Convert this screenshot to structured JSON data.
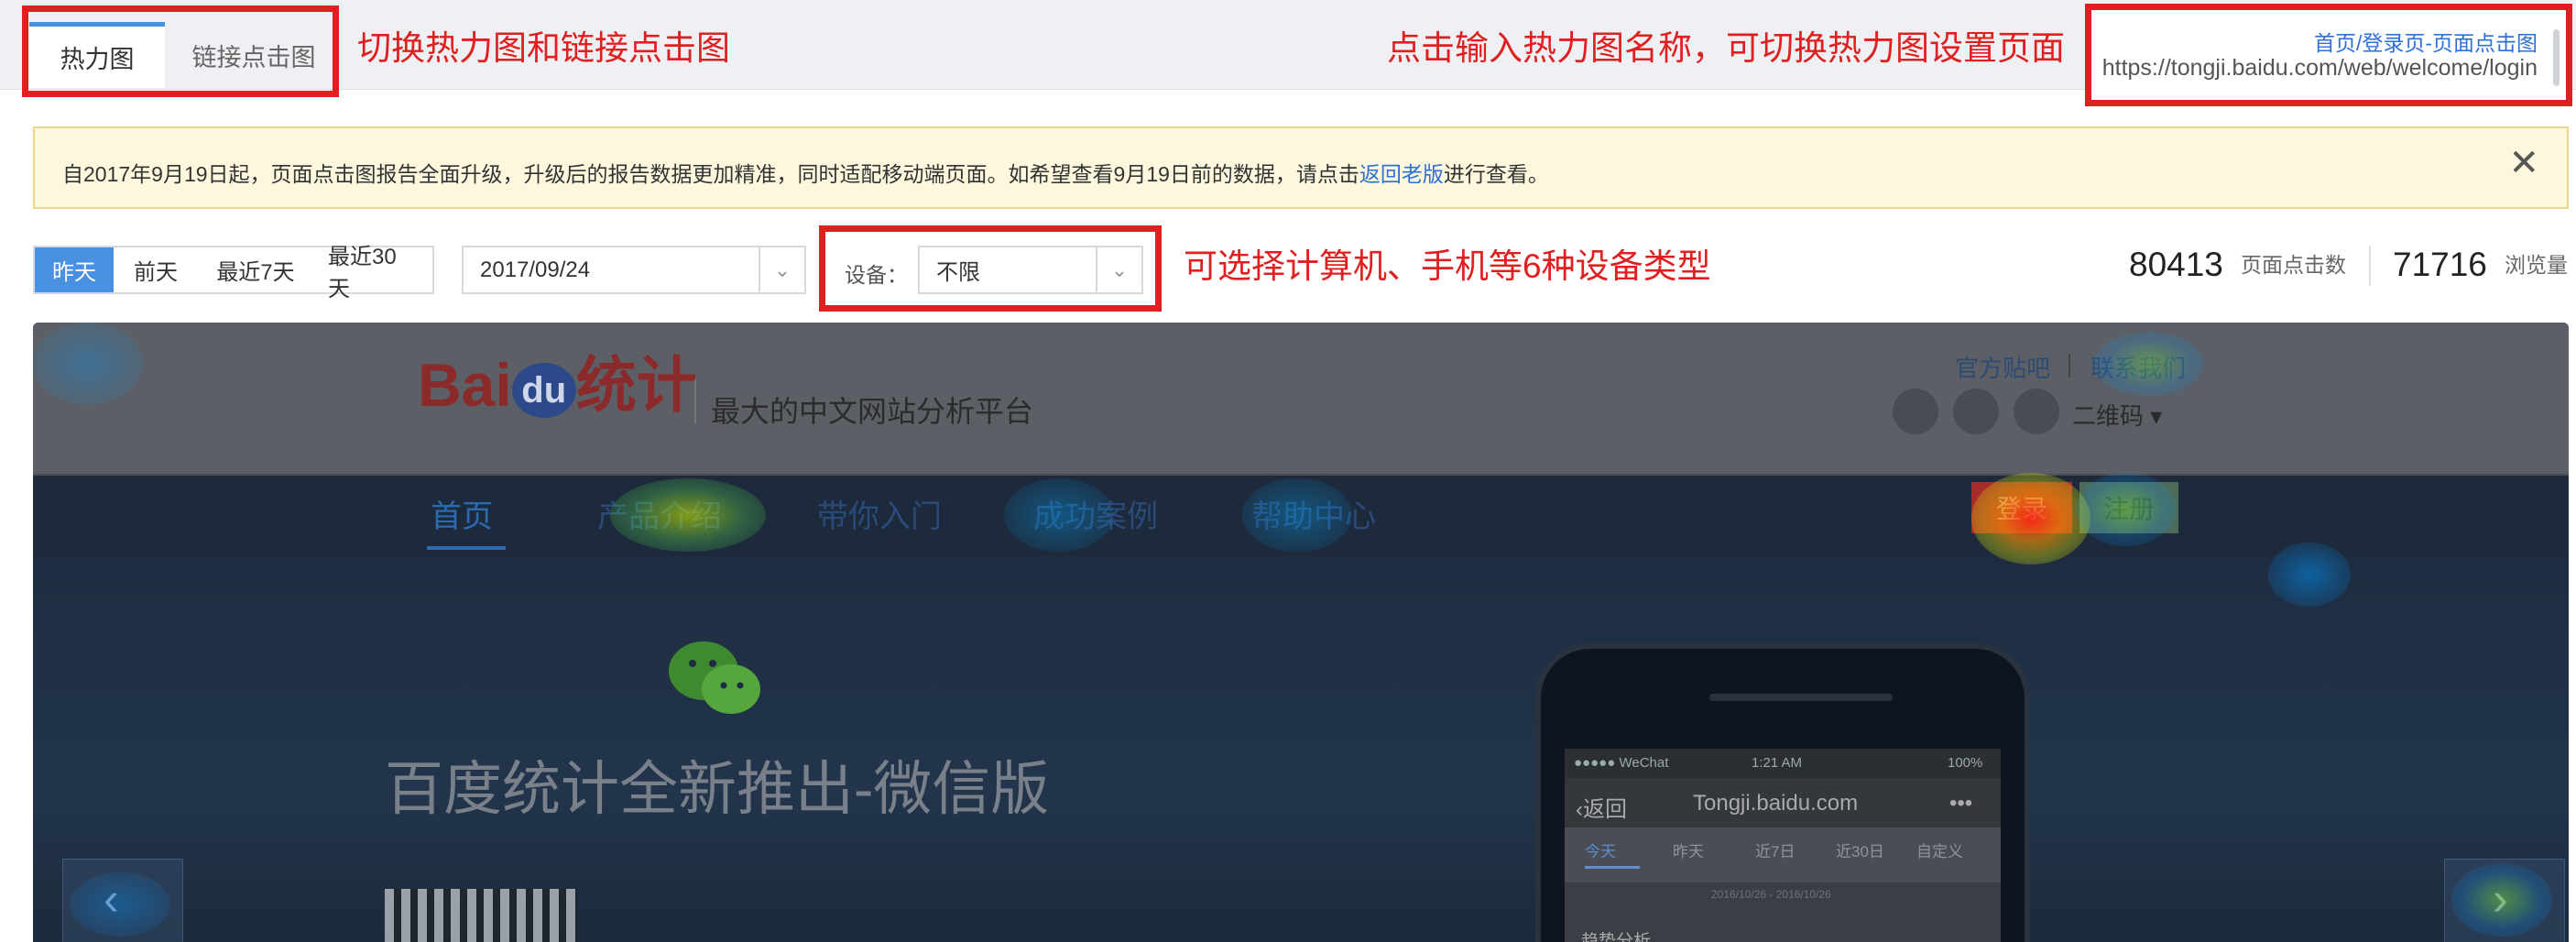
{
  "tabs": {
    "heatmap": "热力图",
    "link_click": "链接点击图"
  },
  "annotations": {
    "tabs_note": "切换热力图和链接点击图",
    "page_note": "点击输入热力图名称，可切换热力图设置页面",
    "device_note": "可选择计算机、手机等6种设备类型"
  },
  "page_selector": {
    "title": "首页/登录页-页面点击图",
    "url": "https://tongji.baidu.com/web/welcome/login"
  },
  "notice": {
    "text_before": "自2017年9月19日起，页面点击图报告全面升级，升级后的报告数据更加精准，同时适配移动端页面。如希望查看9月19日前的数据，请点击",
    "link": "返回老版",
    "text_after": "进行查看。",
    "close": "✕"
  },
  "filters": {
    "ranges": [
      "昨天",
      "前天",
      "最近7天",
      "最近30天"
    ],
    "active_range": "昨天",
    "date": "2017/09/24",
    "device_label": "设备：",
    "device_value": "不限"
  },
  "stats": {
    "clicks_value": "80413",
    "clicks_label": "页面点击数",
    "views_value": "71716",
    "views_label": "浏览量"
  },
  "preview": {
    "logo_bai": "Bai",
    "logo_du": "du",
    "logo_tongji": "统计",
    "slogan": "最大的中文网站分析平台",
    "top_link_1": "官方贴吧",
    "top_link_2": "联系我们",
    "qr_label": "二维码",
    "menu": [
      "首页",
      "产品介绍",
      "带你入门",
      "成功案例",
      "帮助中心"
    ],
    "login": "登录",
    "register": "注册",
    "headline": "百度统计全新推出-微信版",
    "phone": {
      "carrier": "●●●●● WeChat",
      "time": "1:21 AM",
      "battery": "100%",
      "back": "返回",
      "site": "Tongji.baidu.com",
      "more": "•••",
      "tabs": [
        "今天",
        "昨天",
        "近7日",
        "近30日",
        "自定义"
      ],
      "range": "2016/10/26 - 2016/10/26",
      "trend": "趋势分析"
    }
  },
  "colors": {
    "accent": "#4a90e2",
    "annotation_red": "#e02020",
    "link_blue": "#2f6fd8",
    "notice_bg": "#fdf8dd"
  }
}
